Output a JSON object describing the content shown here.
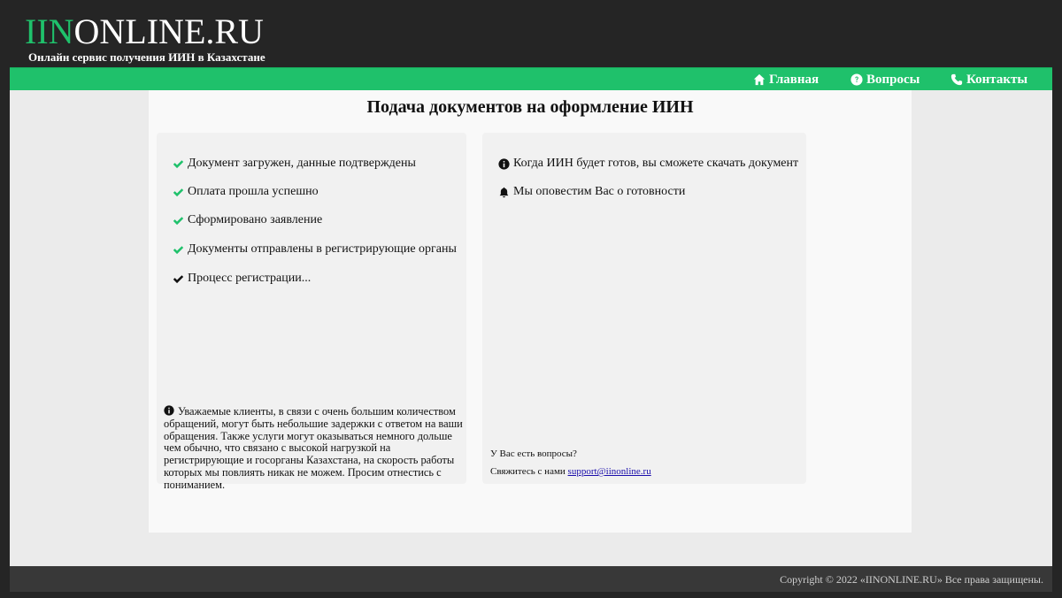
{
  "header": {
    "logo_accent": "IIN",
    "logo_rest": "ONLINE.RU",
    "tagline": "Онлайн сервис получения ИИН в Казахстане"
  },
  "nav": {
    "home": "Главная",
    "faq": "Вопросы",
    "contacts": "Контакты"
  },
  "main": {
    "title": "Подача документов на оформление ИИН",
    "steps": [
      "Документ загружен, данные подтверждены",
      "Оплата прошла успешно",
      "Сформировано заявление",
      "Документы отправлены в регистрирующие органы",
      "Процесс регистрации..."
    ],
    "notice": "Уважаемые клиенты, в связи с очень большим количеством обращений, могут быть небольшие задержки с ответом на ваши обращения. Также услуги могут оказываться немного дольше чем обычно, что связано с высокой нагрузкой на регистрирующие и госорганы Казахстана, на скорость работы которых мы повлиять никак не можем. Просим отнестись с пониманием.",
    "right_info": "Когда ИИН будет готов, вы сможете скачать документ",
    "right_notify": "Мы оповестим Вас о готовности",
    "questions": "У Вас есть вопросы?",
    "contact_prefix": "Свяжитесь с нами",
    "contact_email": "support@iinonline.ru"
  },
  "footer": {
    "copyright": "Copyright © 2022 «IINONLINE.RU» Все права защищены."
  },
  "colors": {
    "accent": "#1fc16b",
    "dark": "#252525"
  }
}
